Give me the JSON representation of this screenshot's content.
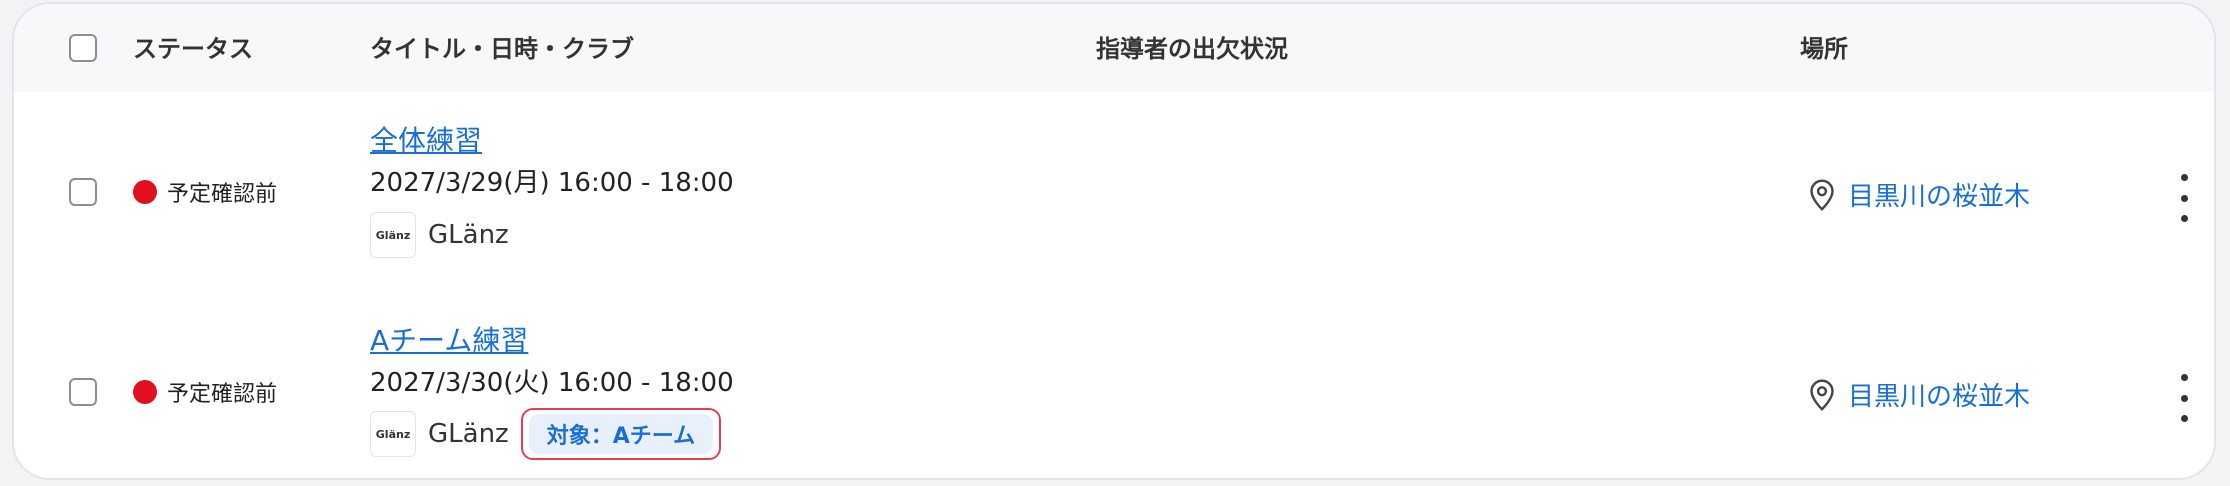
{
  "columns": {
    "status": "ステータス",
    "title": "タイトル・日時・クラブ",
    "attendance": "指導者の出欠状況",
    "place": "場所"
  },
  "rows": [
    {
      "status": "予定確認前",
      "status_color": "#e01020",
      "title": "全体練習",
      "datetime": "2027/3/29(月) 16:00 - 18:00",
      "club_logo": "Glänz",
      "club_name": "GLänz",
      "place": "目黒川の桜並木"
    },
    {
      "status": "予定確認前",
      "status_color": "#e01020",
      "title": "Aチーム練習",
      "datetime": "2027/3/30(火) 16:00 - 18:00",
      "club_logo": "Glänz",
      "club_name": "GLänz",
      "target": "対象：Aチーム",
      "place": "目黒川の桜並木"
    }
  ],
  "icons": {
    "place": "map-pin-icon",
    "menu": "more-vertical-icon"
  }
}
